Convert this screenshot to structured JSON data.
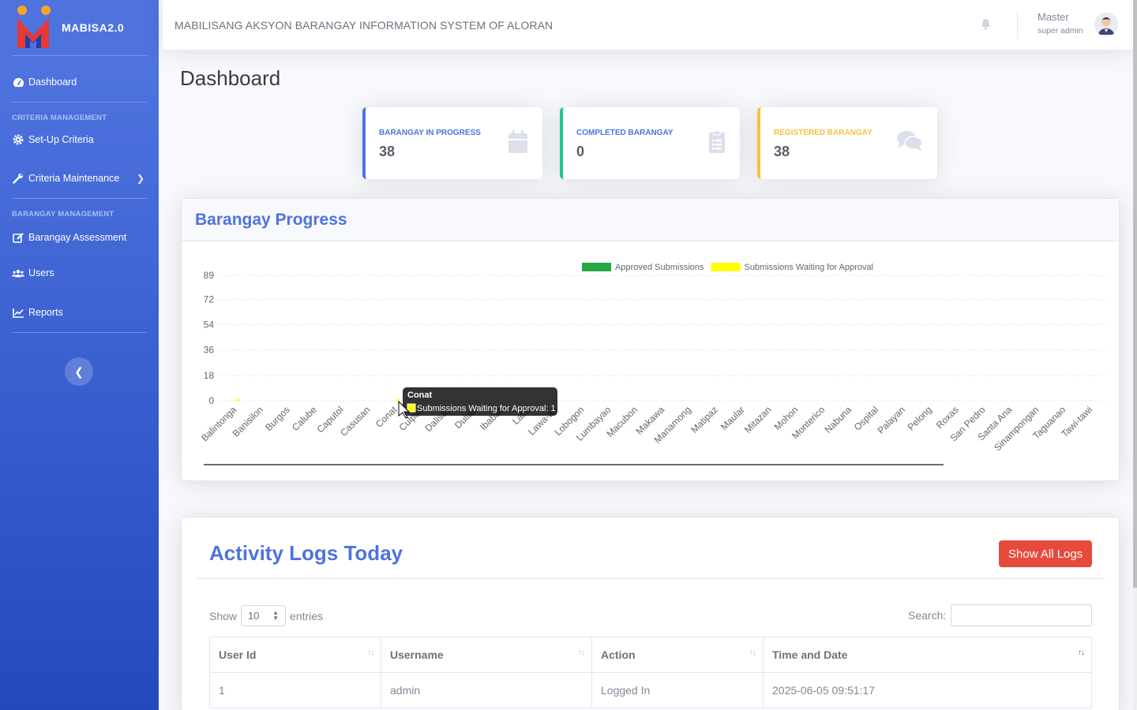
{
  "brand": {
    "name": "MABISA2.0"
  },
  "sidebar": {
    "dashboard": "Dashboard",
    "heading_criteria": "CRITERIA MANAGEMENT",
    "setup_criteria": "Set-Up Criteria",
    "criteria_maintenance": "Criteria Maintenance",
    "heading_barangay": "BARANGAY MANAGEMENT",
    "barangay_assessment": "Barangay Assessment",
    "users": "Users",
    "reports": "Reports"
  },
  "topbar": {
    "system_title": "MABILISANG AKSYON BARANGAY INFORMATION SYSTEM OF ALORAN",
    "user_name": "Master",
    "user_role": "super admin"
  },
  "page": {
    "title": "Dashboard"
  },
  "stats": [
    {
      "label": "BARANGAY IN PROGRESS",
      "value": "38",
      "icon": "calendar-icon"
    },
    {
      "label": "COMPLETED BARANGAY",
      "value": "0",
      "icon": "clipboard-list-icon"
    },
    {
      "label": "REGISTERED BARANGAY",
      "value": "38",
      "icon": "comments-icon"
    }
  ],
  "progress": {
    "title": "Barangay Progress"
  },
  "chart_data": {
    "type": "bar",
    "categories": [
      "Balintonga",
      "Banisilon",
      "Burgos",
      "Calube",
      "Caputol",
      "Casusan",
      "Conat",
      "Culpan",
      "Dalisay",
      "Dullan",
      "Ibabao",
      "Labo",
      "Lawa-an",
      "Lobogon",
      "Lumbayao",
      "Macubon",
      "Makawa",
      "Manamong",
      "Matipaz",
      "Maular",
      "Mitazan",
      "Mohon",
      "Monterico",
      "Nabuna",
      "Ospital",
      "Palayan",
      "Pelong",
      "Roxas",
      "San Pedro",
      "Santa Ana",
      "Sinampongan",
      "Taguanao",
      "Tawi-tawi"
    ],
    "series": [
      {
        "name": "Approved Submissions",
        "color": "#28a745",
        "values": [
          0,
          0,
          0,
          0,
          0,
          0,
          0,
          0,
          0,
          0,
          0,
          0,
          0,
          0,
          0,
          0,
          0,
          0,
          0,
          0,
          0,
          0,
          0,
          0,
          0,
          0,
          0,
          0,
          0,
          0,
          0,
          0,
          0
        ]
      },
      {
        "name": "Submissions Waiting for Approval",
        "color": "#ffff00",
        "values": [
          1,
          0,
          0,
          0,
          0,
          0,
          1,
          0,
          0,
          0,
          0,
          0,
          0,
          0,
          0,
          0,
          0,
          0,
          0,
          0,
          0,
          0,
          0,
          0,
          0,
          0,
          0,
          0,
          0,
          0,
          0,
          0,
          0
        ]
      }
    ],
    "yticks": [
      "0",
      "18",
      "36",
      "54",
      "72",
      "89"
    ],
    "ylim": [
      0,
      89
    ],
    "legend": "top-center",
    "tooltip": {
      "title": "Conat",
      "text": "Submissions Waiting for Approval: 1"
    }
  },
  "logs": {
    "title": "Activity Logs Today",
    "show_all": "Show All Logs",
    "show_label": "Show",
    "entries_value": "10",
    "entries_label": "entries",
    "search_label": "Search:",
    "columns": [
      "User Id",
      "Username",
      "Action",
      "Time and Date"
    ],
    "rows": [
      [
        "1",
        "admin",
        "Logged In",
        "2025-06-05 09:51:17"
      ]
    ]
  }
}
